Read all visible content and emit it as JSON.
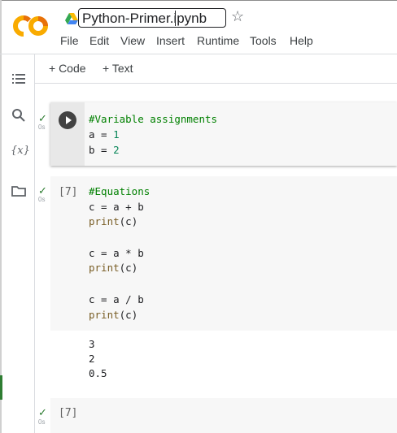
{
  "notebook": {
    "title": "Python-Primer.ipynb"
  },
  "menu": [
    "File",
    "Edit",
    "View",
    "Insert",
    "Runtime",
    "Tools",
    "Help"
  ],
  "toolbar": {
    "code_label": "+ Code",
    "text_label": "+ Text"
  },
  "sidebar": {
    "variables_icon_text": "{x}"
  },
  "cells": [
    {
      "exec": "",
      "status": "✓",
      "time": "0s",
      "lines": [
        "#Variable assignments",
        "a = 1",
        "b = 2"
      ]
    },
    {
      "exec": "[7]",
      "status": "✓",
      "time": "0s",
      "lines": [
        "#Equations",
        "c = a + b",
        "print(c)",
        "",
        "c = a * b",
        "print(c)",
        "",
        "c = a / b",
        "print(c)"
      ],
      "output": [
        "3",
        "2",
        "0.5"
      ]
    },
    {
      "exec": "[7]",
      "status": "✓",
      "time": "0s",
      "lines": []
    }
  ],
  "colors": {
    "comment": "#008000",
    "number": "#098658",
    "function": "#795e26",
    "check": "#2e7d32"
  }
}
